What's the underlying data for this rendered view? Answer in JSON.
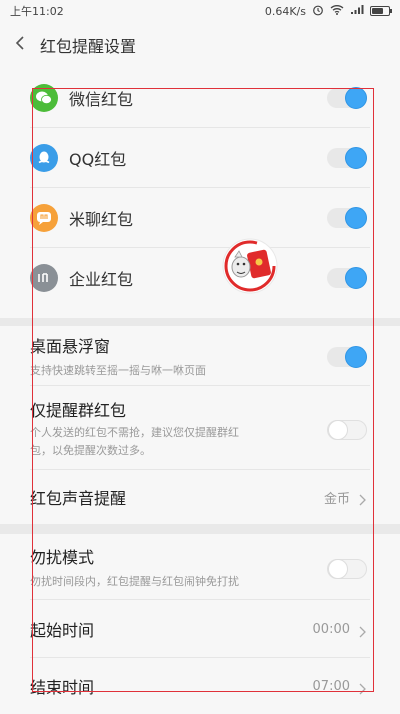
{
  "status_bar": {
    "time": "上午11:02",
    "net_speed": "0.64K/s",
    "icons": [
      "alarm-icon",
      "wifi-icon",
      "signal-icon",
      "battery-icon"
    ]
  },
  "header": {
    "back_icon": "chevron-left-icon",
    "title": "红包提醒设置"
  },
  "apps": [
    {
      "name": "wechat",
      "label": "微信红包",
      "icon_color": "#4cbc39",
      "enabled": true
    },
    {
      "name": "qq",
      "label": "QQ红包",
      "icon_color": "#3a9de8",
      "enabled": true
    },
    {
      "name": "miliao",
      "label": "米聊红包",
      "icon_color": "#f6a13a",
      "enabled": true
    },
    {
      "name": "enterprise",
      "label": "企业红包",
      "icon_color": "#8a9096",
      "enabled": true
    }
  ],
  "settings": {
    "floating_window": {
      "label": "桌面悬浮窗",
      "desc": "支持快速跳转至摇一摇与咻一咻页面",
      "enabled": true
    },
    "group_only": {
      "label": "仅提醒群红包",
      "desc1": "个人发送的红包不需抢，建议您仅提醒群红",
      "desc2": "包，以免提醒次数过多。",
      "enabled": false
    },
    "sound": {
      "label": "红包声音提醒",
      "value": "金币"
    }
  },
  "dnd": {
    "mode": {
      "label": "勿扰模式",
      "desc": "勿扰时间段内，红包提醒与红包闹钟免打扰",
      "enabled": false
    },
    "start": {
      "label": "起始时间",
      "value": "00:00"
    },
    "end": {
      "label": "结束时间",
      "value": "07:00"
    }
  },
  "colors": {
    "accent": "#3ea6f5",
    "overlay_border": "#e0313a",
    "envelope_red": "#e02b2b"
  }
}
